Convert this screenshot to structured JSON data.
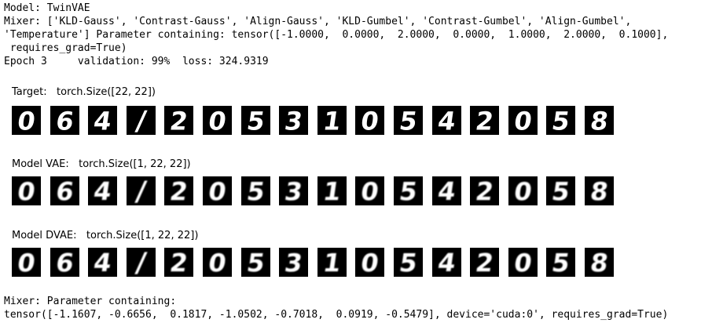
{
  "header": {
    "model_line": "Model: TwinVAE",
    "mixer_line1": "Mixer: ['KLD-Gauss', 'Contrast-Gauss', 'Align-Gauss', 'KLD-Gumbel', 'Contrast-Gumbel', 'Align-Gumbel',",
    "mixer_line2": "'Temperature'] Parameter containing: tensor([-1.0000,  0.0000,  2.0000,  0.0000,  1.0000,  2.0000,  0.1000],",
    "mixer_line3": " requires_grad=True)",
    "epoch_line": "Epoch 3     validation: 99%  loss: 324.9319"
  },
  "panels": [
    {
      "title": "Target:",
      "size": "torch.Size([22, 22])",
      "style": "sharp"
    },
    {
      "title": "Model VAE:",
      "size": "torch.Size([1, 22, 22])",
      "style": "soft"
    },
    {
      "title": "Model DVAE:",
      "size": "torch.Size([1, 22, 22])",
      "style": "soft"
    }
  ],
  "digits": [
    "0",
    "6",
    "4",
    "/",
    "2",
    "0",
    "5",
    "3",
    "1",
    "0",
    "5",
    "4",
    "2",
    "0",
    "5",
    "8"
  ],
  "footer": {
    "line1": "Mixer: Parameter containing:",
    "line2": "tensor([-1.1607, -0.6656,  0.1817, -1.0502, -0.7018,  0.0919, -0.5479], device='cuda:0', requires_grad=True)"
  },
  "colors": {
    "tile_bg": "#000000",
    "digit": "#ffffff",
    "text": "#000000"
  }
}
